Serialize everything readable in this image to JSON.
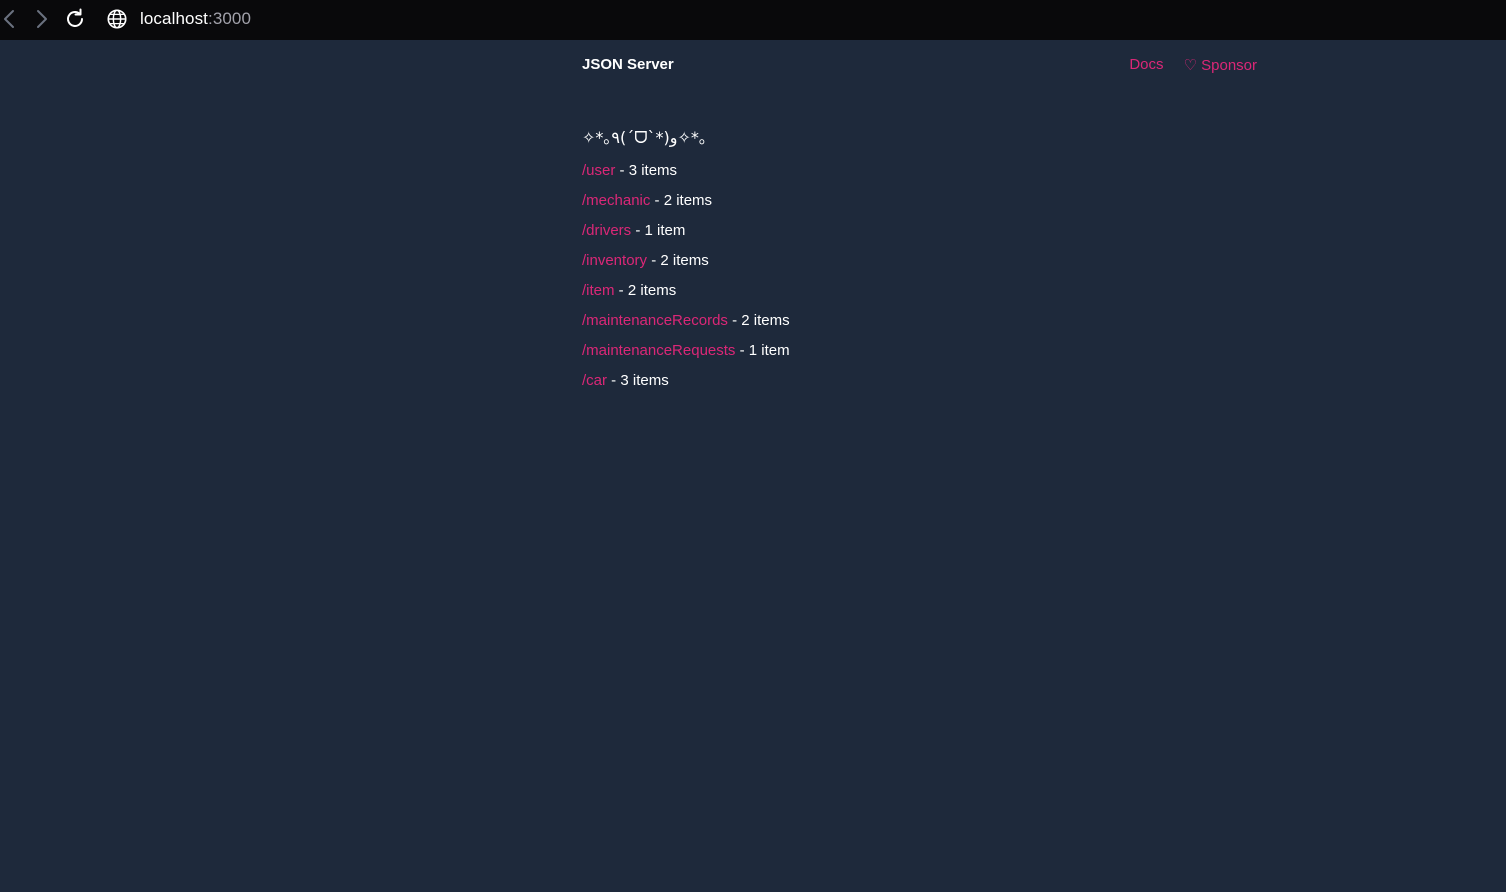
{
  "browser": {
    "host": "localhost",
    "port": ":3000",
    "icons": {
      "back": "chevron-left-icon",
      "forward": "chevron-right-icon",
      "reload": "reload-icon",
      "site": "globe-icon"
    }
  },
  "header": {
    "brand": "JSON Server",
    "links": [
      {
        "label": "Docs"
      },
      {
        "label": "♡ Sponsor"
      }
    ]
  },
  "kaomoji": "✧*｡٩(ˊᗜˋ*)و✧*｡",
  "resources": [
    {
      "path": "/user",
      "count": " - 3 items"
    },
    {
      "path": "/mechanic",
      "count": " - 2 items"
    },
    {
      "path": "/drivers",
      "count": " - 1 item"
    },
    {
      "path": "/inventory",
      "count": " - 2 items"
    },
    {
      "path": "/item",
      "count": " - 2 items"
    },
    {
      "path": "/maintenanceRecords",
      "count": " - 2 items"
    },
    {
      "path": "/maintenanceRequests",
      "count": " - 1 item"
    },
    {
      "path": "/car",
      "count": " - 3 items"
    }
  ],
  "colors": {
    "page_bg": "#1e293b",
    "browser_bg": "#09090b",
    "accent": "#db2777",
    "text": "#ffffff"
  }
}
